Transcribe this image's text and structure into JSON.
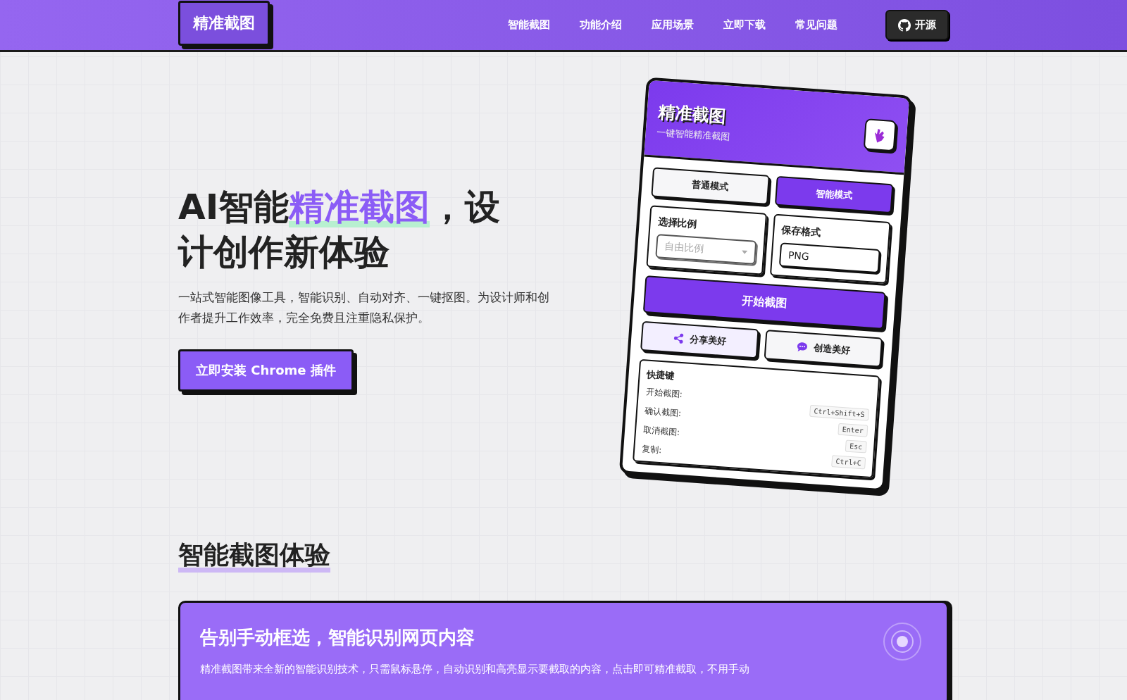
{
  "header": {
    "logo": "精准截图",
    "nav": [
      {
        "label": "智能截图"
      },
      {
        "label": "功能介绍"
      },
      {
        "label": "应用场景"
      },
      {
        "label": "立即下载"
      },
      {
        "label": "常见问题"
      }
    ],
    "github_button": "开源"
  },
  "hero": {
    "heading": [
      {
        "text": "AI智能",
        "highlight": false
      },
      {
        "text": "精准截图",
        "highlight": true
      },
      {
        "text": "，设计创作新体验",
        "highlight": false
      }
    ],
    "description": "一站式智能图像工具，智能识别、自动对齐、一键抠图。为设计师和创作者提升工作效率，完全免费且注重隐私保护。",
    "cta": "立即安装 Chrome 插件"
  },
  "panel": {
    "title": "精准截图",
    "subtitle": "一键智能精准截图",
    "modes": [
      {
        "label": "普通模式",
        "selected": false
      },
      {
        "label": "智能模式",
        "selected": true
      }
    ],
    "ratio": {
      "label": "选择比例",
      "value": "自由比例"
    },
    "format": {
      "label": "保存格式",
      "value": "PNG"
    },
    "start_button": "开始截图",
    "actions": [
      {
        "kind": "share",
        "label": "分享美好"
      },
      {
        "kind": "chat",
        "label": "创造美好"
      }
    ],
    "shortcuts": {
      "title": "快捷键",
      "labels": [
        "开始截图:",
        "确认截图:",
        "取消截图:",
        "复制:"
      ],
      "keys": [
        "Ctrl+Shift+S",
        "Enter",
        "Esc",
        "Ctrl+C"
      ]
    }
  },
  "section": {
    "title": "智能截图体验",
    "card": {
      "title": "告别手动框选，智能识别网页内容",
      "text": "精准截图带来全新的智能识别技术，只需鼠标悬停，自动识别和高亮显示要截取的内容，点击即可精准截取，不用手动"
    }
  }
}
